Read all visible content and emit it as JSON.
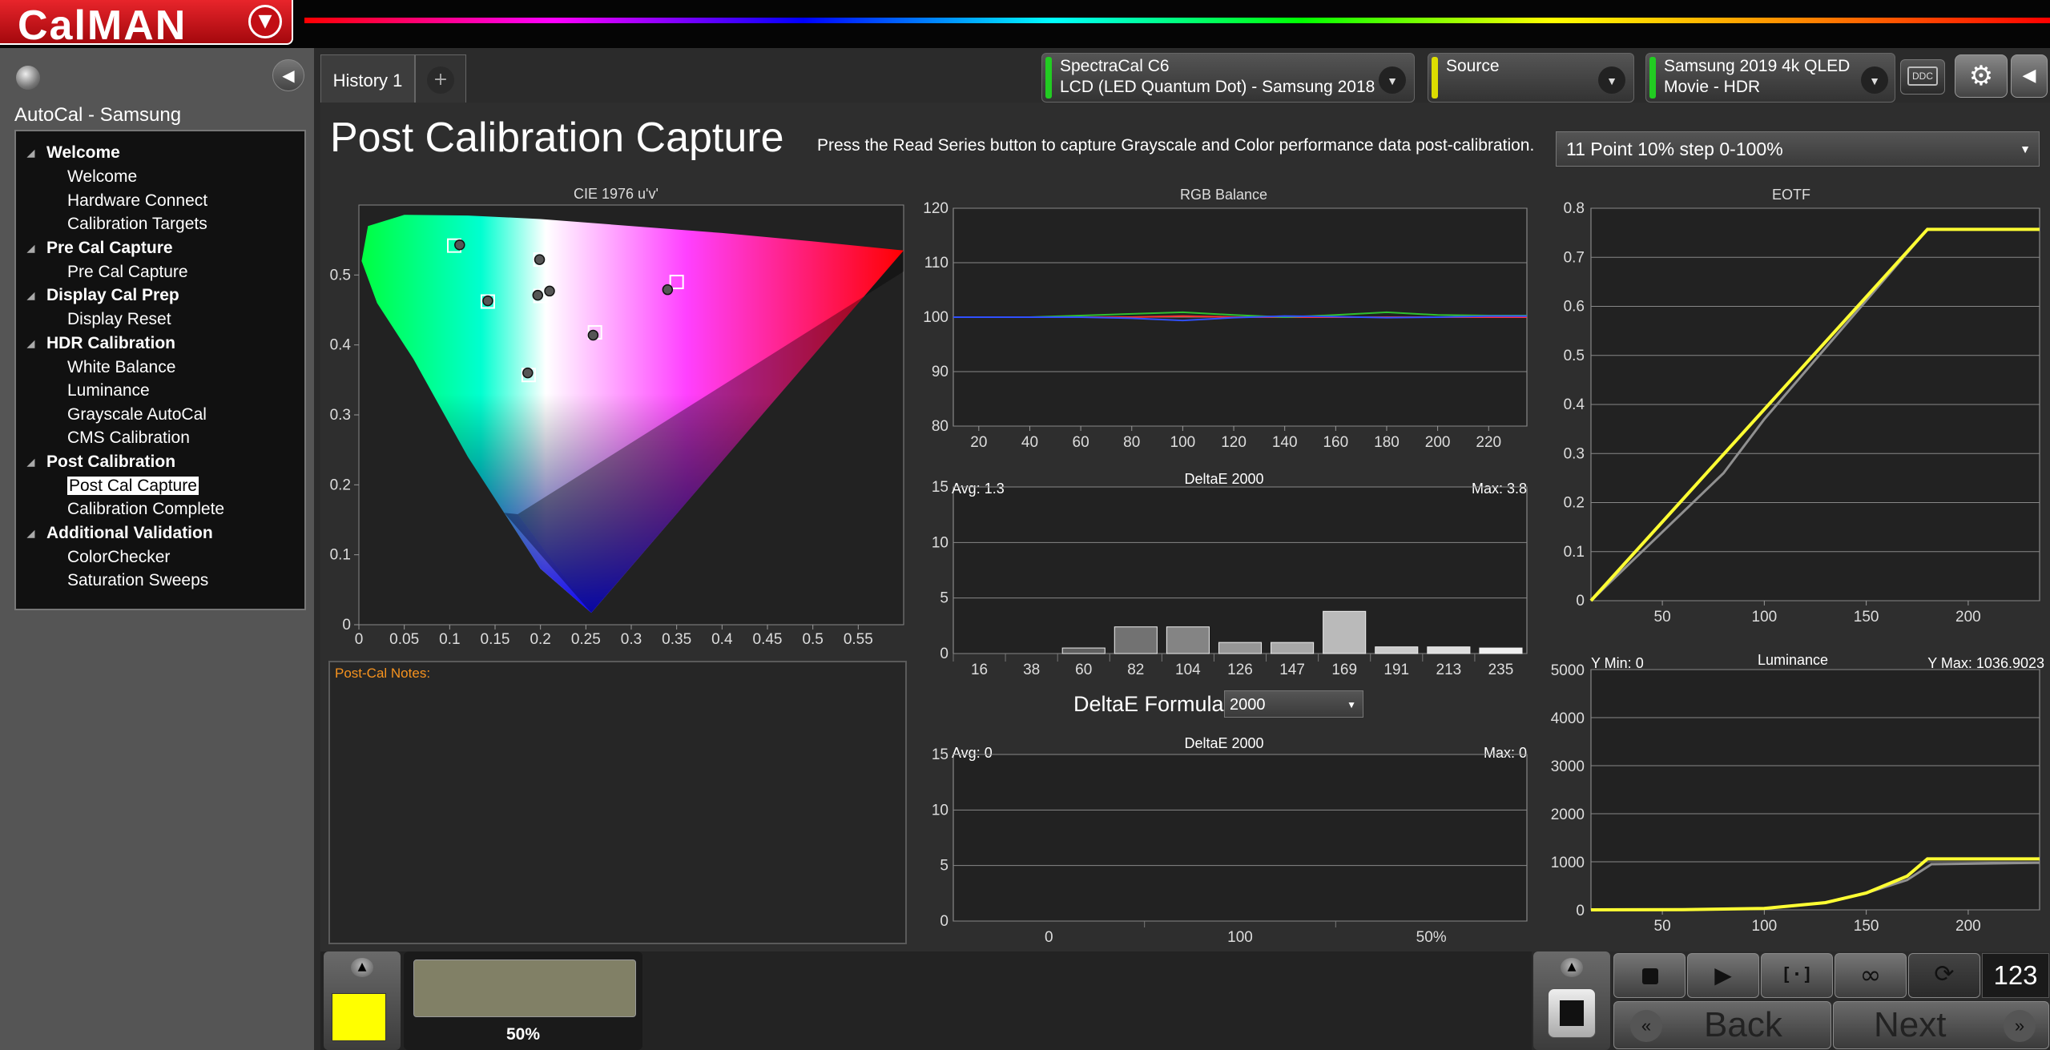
{
  "app": {
    "logo_text": "CalMAN"
  },
  "sidebar": {
    "title": "AutoCal - Samsung",
    "groups": [
      {
        "label": "Welcome",
        "items": [
          "Welcome",
          "Hardware Connect",
          "Calibration Targets"
        ]
      },
      {
        "label": "Pre Cal Capture",
        "items": [
          "Pre Cal Capture"
        ]
      },
      {
        "label": "Display Cal Prep",
        "items": [
          "Display Reset"
        ]
      },
      {
        "label": "HDR Calibration",
        "items": [
          "White Balance",
          "Luminance",
          "Grayscale AutoCal",
          "CMS Calibration"
        ]
      },
      {
        "label": "Post Calibration",
        "items": [
          "Post Cal Capture",
          "Calibration Complete"
        ]
      },
      {
        "label": "Additional Validation",
        "items": [
          "ColorChecker",
          "Saturation Sweeps"
        ]
      }
    ],
    "selected": "Post Cal Capture"
  },
  "tabs": {
    "history": "History 1",
    "add": "+"
  },
  "devices": {
    "meter": {
      "line1": "SpectraCal C6",
      "line2": "LCD (LED Quantum Dot) - Samsung 2018",
      "stripe": "#22cc22"
    },
    "source": {
      "line1": "Source",
      "line2": "",
      "stripe": "#dddd00"
    },
    "display": {
      "line1": "Samsung 2019 4k QLED",
      "line2": "Movie - HDR",
      "stripe": "#22cc22"
    },
    "ddc": "DDC"
  },
  "page": {
    "title": "Post Calibration Capture",
    "instruction": "Press the Read Series button to capture Grayscale and Color performance data post-calibration.",
    "series_select": "11 Point 10% step 0-100%",
    "notes_label": "Post-Cal Notes:",
    "deltae_formula_label": "DeltaE Formula",
    "deltae_formula_value": "2000"
  },
  "charts": {
    "cie": {
      "title": "CIE 1976 u'v'",
      "xticks": [
        "0",
        "0.05",
        "0.1",
        "0.15",
        "0.2",
        "0.25",
        "0.3",
        "0.35",
        "0.4",
        "0.45",
        "0.5",
        "0.55"
      ],
      "yticks": [
        "0",
        "0.1",
        "0.2",
        "0.3",
        "0.4",
        "0.5"
      ],
      "targets": [
        [
          0.105,
          0.542
        ],
        [
          0.142,
          0.462
        ],
        [
          0.2,
          0.522
        ],
        [
          0.2,
          0.47
        ],
        [
          0.26,
          0.418
        ],
        [
          0.35,
          0.49
        ],
        [
          0.187,
          0.357
        ]
      ],
      "measured": [
        [
          0.111,
          0.543
        ],
        [
          0.142,
          0.463
        ],
        [
          0.199,
          0.522
        ],
        [
          0.21,
          0.477
        ],
        [
          0.258,
          0.414
        ],
        [
          0.34,
          0.479
        ],
        [
          0.186,
          0.36
        ],
        [
          0.197,
          0.471
        ]
      ]
    },
    "rgb_balance": {
      "title": "RGB Balance",
      "xticks": [
        "20",
        "40",
        "60",
        "80",
        "100",
        "120",
        "140",
        "160",
        "180",
        "200",
        "220"
      ],
      "yticks": [
        "80",
        "90",
        "100",
        "110",
        "120"
      ],
      "ylim": [
        80,
        120
      ],
      "x": [
        10,
        20,
        40,
        60,
        80,
        100,
        120,
        140,
        160,
        180,
        200,
        220,
        235
      ],
      "series": [
        {
          "color": "#ff3030",
          "values": [
            100,
            100,
            100,
            100,
            100,
            100.2,
            100,
            100,
            100,
            100,
            100,
            100,
            100
          ]
        },
        {
          "color": "#30c030",
          "values": [
            100,
            100,
            100,
            100.3,
            100.6,
            100.9,
            100.4,
            100,
            100.4,
            100.9,
            100.4,
            100.3,
            100.3
          ]
        },
        {
          "color": "#3050ff",
          "values": [
            100,
            100,
            100,
            100,
            99.8,
            99.4,
            99.9,
            100.2,
            100.1,
            99.9,
            100,
            100.2,
            100.2
          ]
        }
      ]
    },
    "deltae_gray": {
      "title": "DeltaE 2000",
      "avg": "Avg: 1.3",
      "max": "Max: 3.8",
      "yticks": [
        "0",
        "5",
        "10",
        "15"
      ],
      "ylim": [
        0,
        15
      ],
      "categories": [
        "16",
        "38",
        "60",
        "82",
        "104",
        "126",
        "147",
        "169",
        "191",
        "213",
        "235"
      ],
      "values": [
        0,
        0,
        0.5,
        2.4,
        2.4,
        1.0,
        1.0,
        3.8,
        0.6,
        0.6,
        0.5
      ]
    },
    "deltae_second": {
      "title": "DeltaE 2000",
      "avg": "Avg: 0",
      "max": "Max: 0",
      "yticks": [
        "0",
        "5",
        "10",
        "15"
      ],
      "ylim": [
        0,
        15
      ],
      "xlabels": [
        "0",
        "100",
        "50%"
      ]
    },
    "eotf": {
      "title": "EOTF",
      "xticks": [
        "50",
        "100",
        "150",
        "200"
      ],
      "yticks": [
        "0",
        "0.1",
        "0.2",
        "0.3",
        "0.4",
        "0.5",
        "0.6",
        "0.7",
        "0.8"
      ],
      "xlim": [
        15,
        235
      ],
      "ylim": [
        0,
        0.8
      ],
      "target": {
        "color": "#ffff33",
        "x": [
          15,
          180,
          235
        ],
        "y": [
          0,
          0.757,
          0.757
        ]
      },
      "measured": {
        "color": "#909090",
        "x": [
          15,
          80,
          100,
          180,
          235
        ],
        "y": [
          0,
          0.26,
          0.37,
          0.757,
          0.757
        ]
      }
    },
    "luminance": {
      "title": "Luminance",
      "ymin_label": "Y Min: 0",
      "ymax_label": "Y Max: 1036.9023",
      "xticks": [
        "50",
        "100",
        "150",
        "200"
      ],
      "yticks": [
        "0",
        "1000",
        "2000",
        "3000",
        "4000",
        "5000"
      ],
      "xlim": [
        15,
        235
      ],
      "ylim": [
        0,
        5000
      ],
      "target": {
        "color": "#ffff33",
        "x": [
          15,
          60,
          100,
          130,
          150,
          170,
          180,
          235
        ],
        "y": [
          0,
          5,
          30,
          150,
          350,
          700,
          1060,
          1060
        ]
      },
      "measured": {
        "color": "#909090",
        "x": [
          15,
          60,
          100,
          130,
          150,
          170,
          182,
          235
        ],
        "y": [
          0,
          5,
          30,
          150,
          350,
          620,
          950,
          980
        ]
      }
    }
  },
  "bottom": {
    "patch_label": "50%",
    "swatch_color": "#ffff00",
    "patch_color": "#818066",
    "counter": "123",
    "back_label": "Back",
    "next_label": "Next"
  }
}
